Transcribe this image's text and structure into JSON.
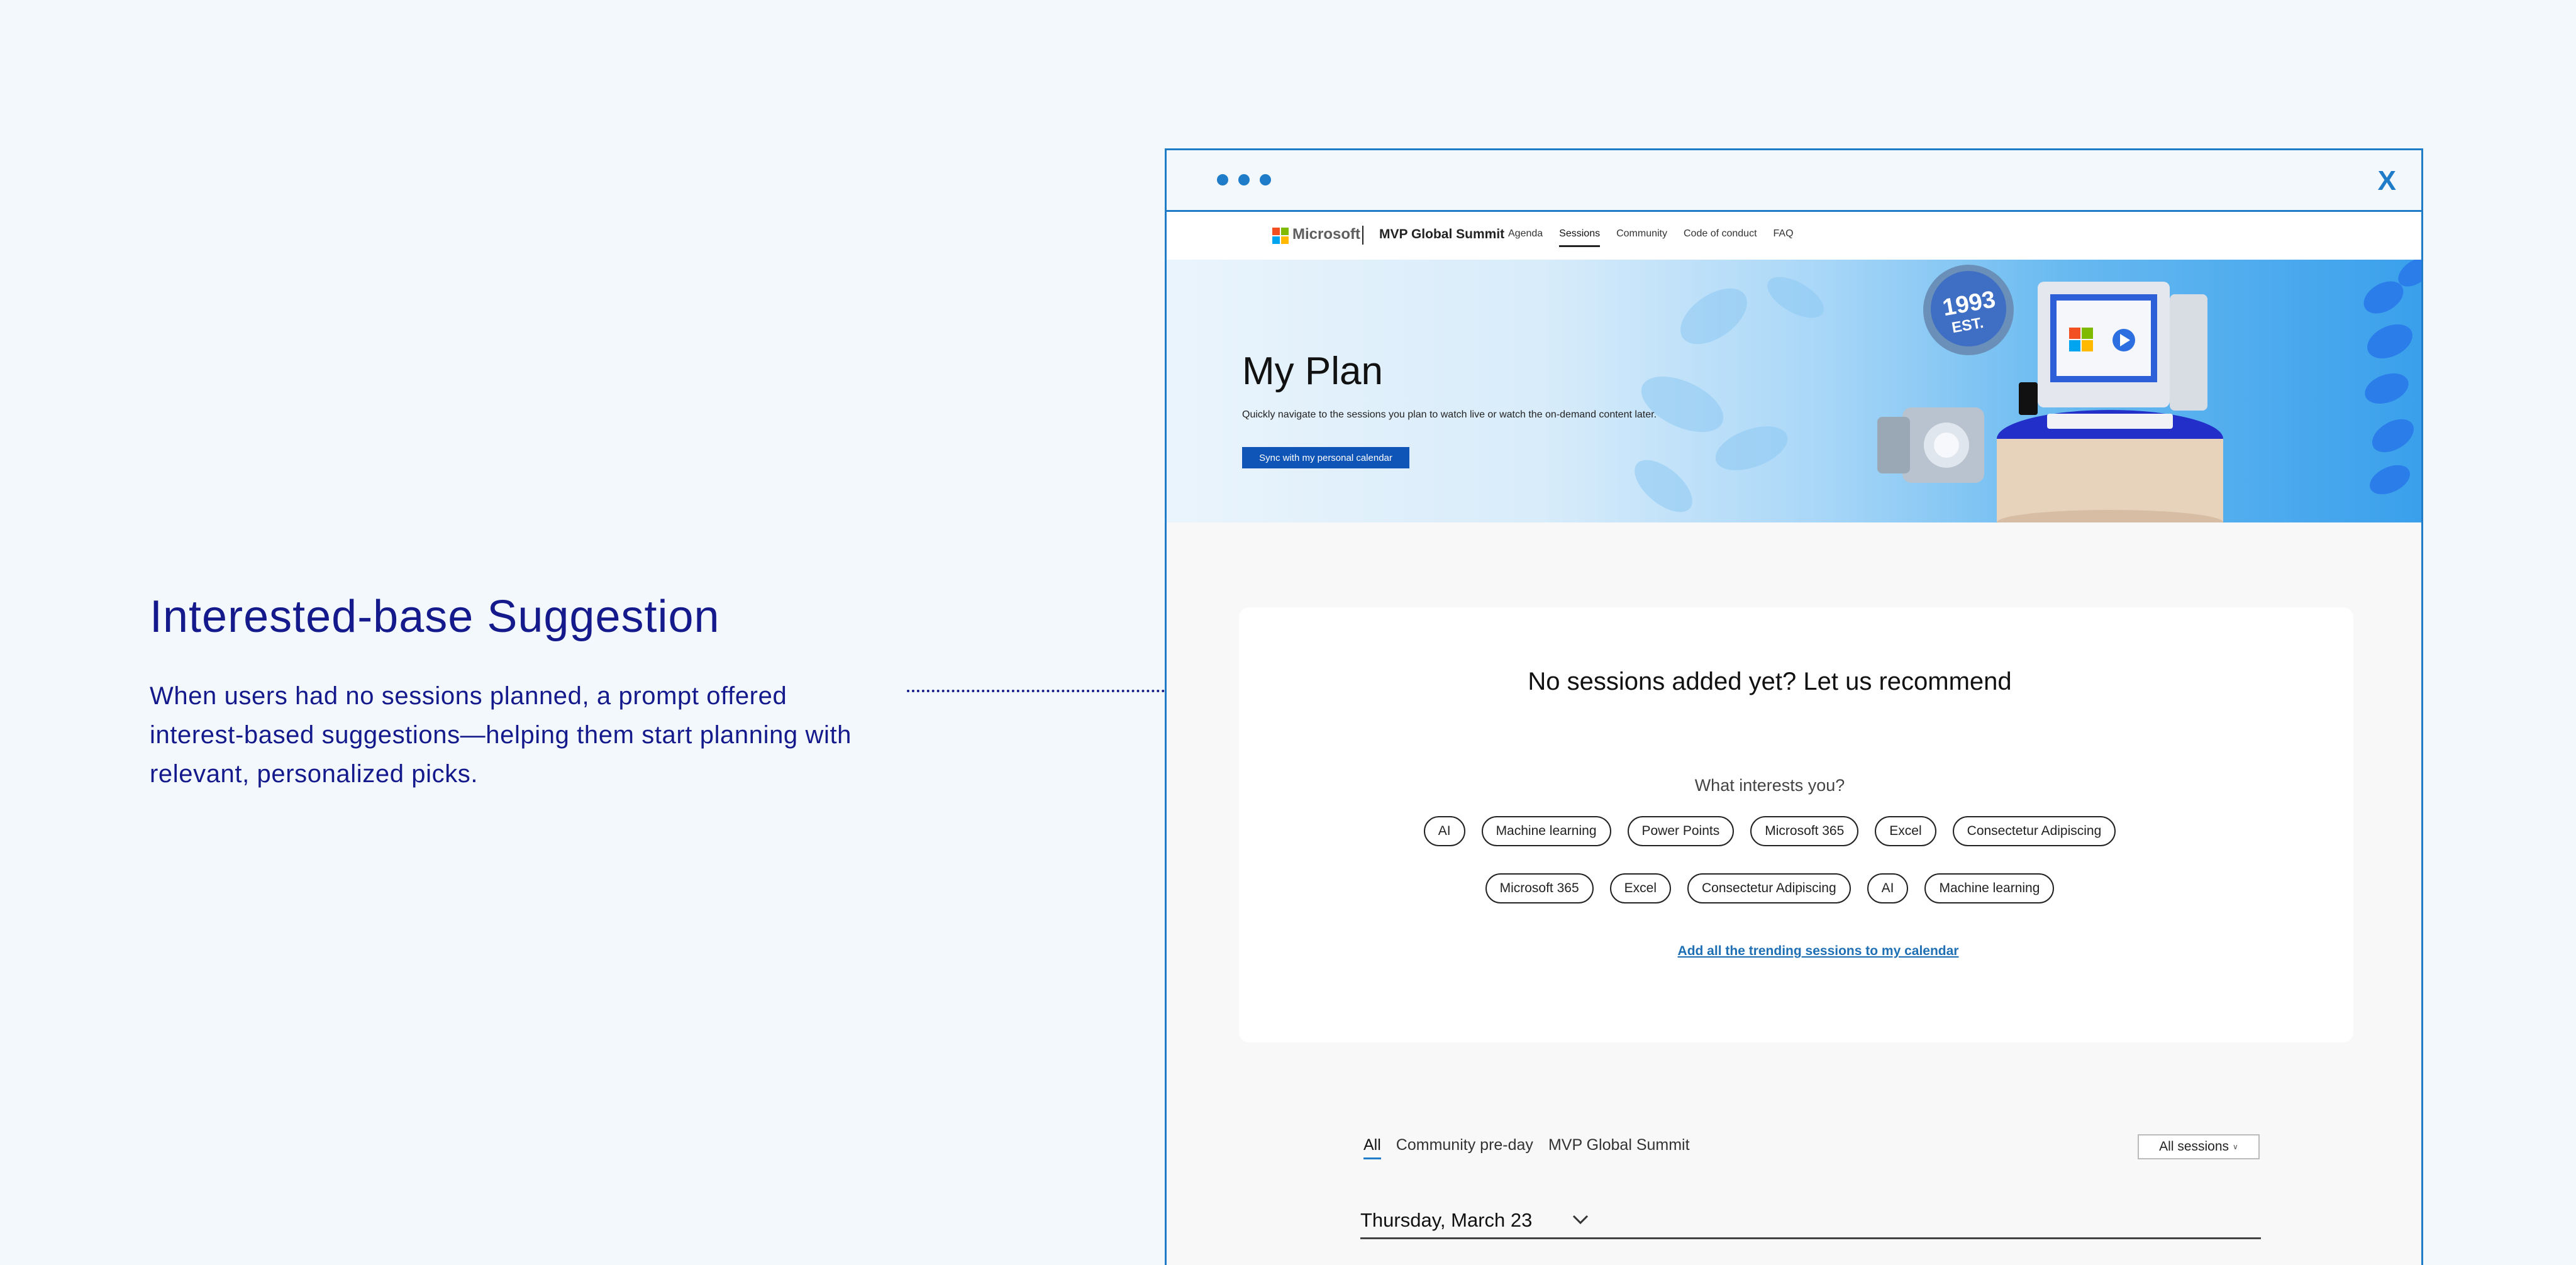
{
  "annotation": {
    "title": "Interested-base Suggestion",
    "description": "When users had no sessions planned, a prompt offered interest-based suggestions—helping them start planning with relevant, personalized picks."
  },
  "browser": {
    "close_label": "X"
  },
  "site_nav": {
    "brand": "Microsoft",
    "site_name": "MVP Global Summit",
    "links": [
      "Agenda",
      "Sessions",
      "Community",
      "Code of conduct",
      "FAQ"
    ],
    "active_link": "Sessions"
  },
  "hero": {
    "title": "My Plan",
    "subtitle": "Quickly navigate to the sessions you plan to watch live or watch the on-demand content later.",
    "button_label": "Sync with my personal calendar",
    "badge_line1": "1993",
    "badge_line2": "EST."
  },
  "recommend": {
    "title": "No sessions added yet? Let us recommend",
    "question": "What interests you?",
    "chips_row1": [
      "AI",
      "Machine learning",
      "Power Points",
      "Microsoft 365",
      "Excel",
      "Consectetur Adipiscing"
    ],
    "chips_row2": [
      "Microsoft 365",
      "Excel",
      "Consectetur Adipiscing",
      "AI",
      "Machine learning"
    ],
    "link_label": "Add all the trending sessions to my calendar"
  },
  "schedule": {
    "tabs": [
      "All",
      "Community pre-day",
      "MVP Global Summit"
    ],
    "active_tab": "All",
    "filter_label": "All sessions",
    "date_label": "Thursday, March 23"
  },
  "colors": {
    "accent": "#1e7cc8",
    "annotation_text": "#141a8c",
    "primary_button": "#0f55b8",
    "link": "#1f6fb5",
    "ms_red": "#f25022",
    "ms_green": "#7fba00",
    "ms_blue": "#00a4ef",
    "ms_yellow": "#ffb900"
  },
  "icons": {
    "window_controls": "dot-icon",
    "close": "close-icon",
    "brand": "microsoft-logo-icon",
    "date_toggle": "chevron-down-icon",
    "filter_toggle": "chevron-down-icon"
  }
}
